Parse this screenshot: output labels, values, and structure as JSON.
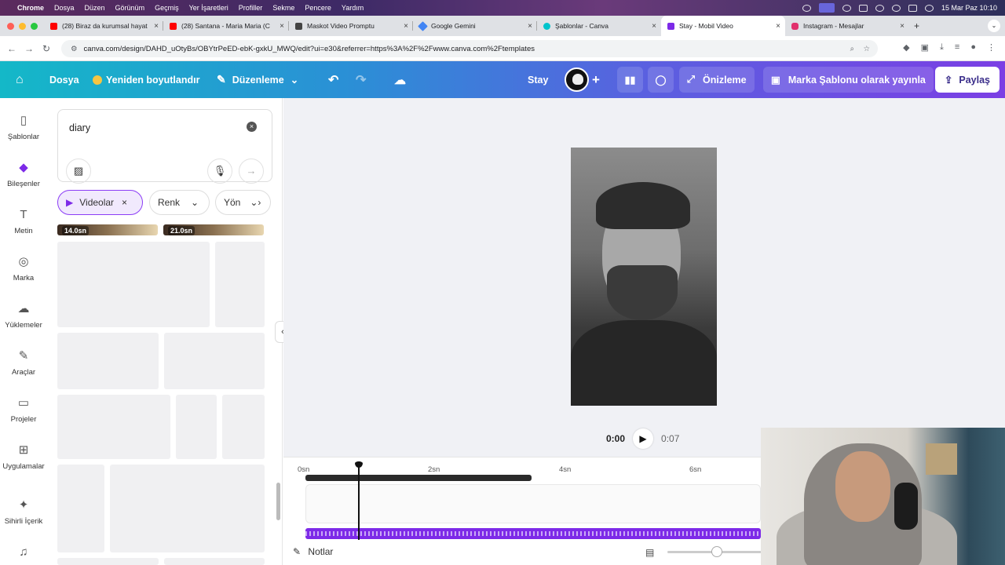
{
  "menubar": {
    "app": "Chrome",
    "items": [
      "Dosya",
      "Düzen",
      "Görünüm",
      "Geçmiş",
      "Yer İşaretleri",
      "Profiller",
      "Sekme",
      "Pencere",
      "Yardım"
    ],
    "datetime": "15 Mar Paz  10:10"
  },
  "tabs": [
    {
      "title": "(28) Biraz da kurumsal hayat",
      "color": "#ff0000"
    },
    {
      "title": "(28) Santana - Maria Maria (C",
      "color": "#ff0000"
    },
    {
      "title": "Maskot Video Promptu",
      "color": "#444444"
    },
    {
      "title": "Google Gemini",
      "color": "#4285f4"
    },
    {
      "title": "Şablonlar - Canva",
      "color": "#00c4cc"
    },
    {
      "title": "Stay - Mobil Video",
      "color": "#7d2ae8"
    },
    {
      "title": "Instagram - Mesajlar",
      "color": "#e1306c"
    }
  ],
  "address": {
    "url": "canva.com/design/DAHD_uOtyBs/OBYtrPeED-ebK-gxkU_MWQ/edit?ui=e30&referrer=https%3A%2F%2Fwww.canva.com%2Ftemplates"
  },
  "canva_bar": {
    "home_icon": "home-icon",
    "file": "Dosya",
    "resize": "Yeniden boyutlandır",
    "edit": "Düzenleme",
    "design_name": "Stay",
    "preview": "Önizleme",
    "publish": "Marka Şablonu olarak yayınla",
    "share": "Paylaş"
  },
  "rail": [
    {
      "label": "Şablonlar",
      "icon": "templates-icon"
    },
    {
      "label": "Bileşenler",
      "icon": "elements-icon"
    },
    {
      "label": "Metin",
      "icon": "text-icon"
    },
    {
      "label": "Marka",
      "icon": "brand-icon"
    },
    {
      "label": "Yüklemeler",
      "icon": "upload-icon"
    },
    {
      "label": "Araçlar",
      "icon": "tools-icon"
    },
    {
      "label": "Projeler",
      "icon": "folder-icon"
    },
    {
      "label": "Uygulamalar",
      "icon": "apps-icon"
    },
    {
      "label": "Sihirli İçerik",
      "icon": "magic-icon"
    },
    {
      "label": "",
      "icon": "music-icon"
    }
  ],
  "panel": {
    "search_value": "diary",
    "chips": [
      "Videolar",
      "Renk",
      "Yön"
    ],
    "durations": [
      "14.0sn",
      "21.0sn"
    ]
  },
  "player": {
    "current": "0:00",
    "total": "0:07"
  },
  "timeline": {
    "ticks": [
      "0sn",
      "2sn",
      "4sn",
      "6sn"
    ],
    "notes": "Notlar"
  },
  "colors": {
    "canva_gradient_start": "#14b8c8",
    "canva_gradient_end": "#7b3fe4",
    "accent": "#7d2ae8"
  }
}
